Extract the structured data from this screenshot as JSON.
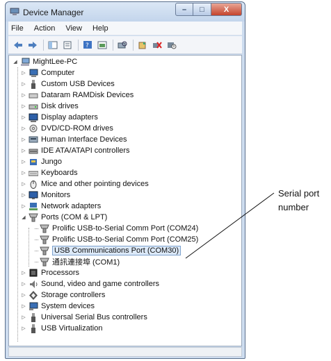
{
  "window": {
    "title": "Device Manager",
    "caption_buttons": {
      "minimize": "–",
      "maximize": "□",
      "close": "X"
    }
  },
  "menu": [
    "File",
    "Action",
    "View",
    "Help"
  ],
  "toolbar_icons": [
    "back-arrow-icon",
    "forward-arrow-icon",
    "show-hide-tree-icon",
    "properties-icon",
    "help-icon",
    "action-view-icon",
    "scan-hardware-icon",
    "update-driver-icon",
    "uninstall-icon",
    "disable-icon"
  ],
  "tree": {
    "root": "MightLee-PC",
    "items": [
      "Computer",
      "Custom USB Devices",
      "Dataram RAMDisk Devices",
      "Disk drives",
      "Display adapters",
      "DVD/CD-ROM drives",
      "Human Interface Devices",
      "IDE ATA/ATAPI controllers",
      "Jungo",
      "Keyboards",
      "Mice and other pointing devices",
      "Monitors",
      "Network adapters",
      "Ports (COM & LPT)",
      "Processors",
      "Sound, video and game controllers",
      "Storage controllers",
      "System devices",
      "Universal Serial Bus controllers",
      "USB Virtualization"
    ],
    "ports_children": [
      "Prolific USB-to-Serial Comm Port (COM24)",
      "Prolific USB-to-Serial Comm Port (COM25)",
      "USB Communications Port (COM30)",
      "通訊連接埠 (COM1)"
    ]
  },
  "callout": {
    "line1": "Serial port",
    "line2": "number"
  }
}
